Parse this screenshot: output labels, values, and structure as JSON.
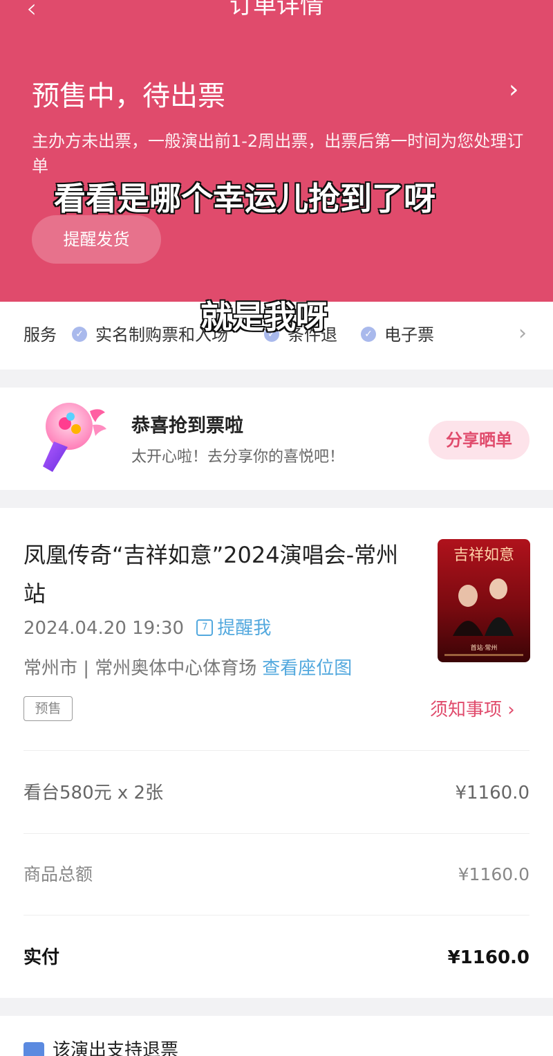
{
  "header": {
    "back_icon": "chevron-left-icon",
    "title": "订单详情",
    "status": "预售中，待出票",
    "description": "主办方未出票，一般演出前1-2周出票，出票后第一时间为您处理订单",
    "remind_button": "提醒发货",
    "background_color": "#e04b6c"
  },
  "captions": {
    "line1": "看看是哪个幸运儿抢到了呀",
    "line2": "就是我呀"
  },
  "service": {
    "label": "服务",
    "items": [
      "实名制购票和入场",
      "条件退",
      "电子票"
    ]
  },
  "congrats": {
    "title": "恭喜抢到票啦",
    "subtitle": "太开心啦！去分享你的喜悦吧！",
    "share_button": "分享晒单"
  },
  "event": {
    "name": "凤凰传奇“吉祥如意”2024演唱会-常州站",
    "datetime": "2024.04.20 19:30",
    "remind_link": "提醒我",
    "venue": "常州市 | 常州奥体中心体育场",
    "seat_map_link": "查看座位图",
    "tag": "预售",
    "notice_link": "须知事项",
    "poster_title": "吉祥如意",
    "poster_caption": "首站·常州"
  },
  "price": {
    "ticket_label": "看台580元 x 2张",
    "ticket_value": "¥1160.0",
    "subtotal_label": "商品总额",
    "subtotal_value": "¥1160.0",
    "paid_label": "实付",
    "paid_value": "¥1160.0"
  },
  "footer": {
    "refund_text": "该演出支持退票"
  }
}
